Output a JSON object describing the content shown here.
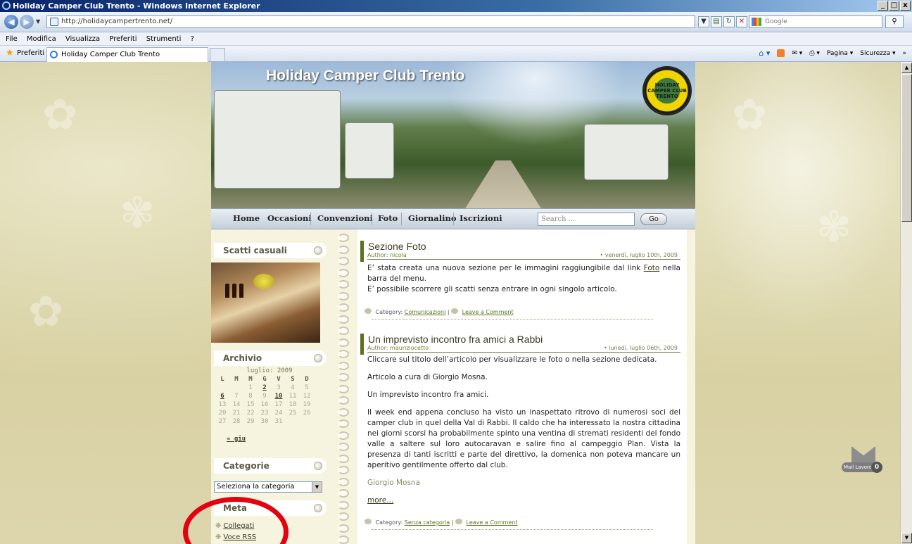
{
  "window": {
    "title": "Holiday Camper Club Trento - Windows Internet Explorer",
    "controls": [
      "_",
      "□",
      "x"
    ]
  },
  "address": {
    "url": "http://holidaycampertrento.net/",
    "search_placeholder": "Google"
  },
  "menu": [
    "File",
    "Modifica",
    "Visualizza",
    "Preferiti",
    "Strumenti",
    "?"
  ],
  "favorites": {
    "label": "Preferiti",
    "tab_title": "Holiday Camper Club Trento"
  },
  "command_bar": {
    "page": "Pagina ▾",
    "security": "Sicurezza ▾"
  },
  "site": {
    "title": "Holiday Camper Club Trento",
    "logo_text": "HOLIDAY CAMPER CLUB TRENTO",
    "nav": [
      "Home",
      "Occasioni",
      "Convenzioni",
      "Foto",
      "Giornalino",
      "Iscrizioni"
    ],
    "search_placeholder": "Search ...",
    "search_button": "Go"
  },
  "sidebar": {
    "random_title": "Scatti casuali",
    "archive_title": "Archivio",
    "calendar": {
      "caption": "luglio: 2009",
      "headers": [
        "L",
        "M",
        "M",
        "G",
        "V",
        "S",
        "D"
      ],
      "weeks": [
        [
          "",
          "",
          "1",
          "2",
          "3",
          "4",
          "5"
        ],
        [
          "6",
          "7",
          "8",
          "9",
          "10",
          "11",
          "12"
        ],
        [
          "13",
          "14",
          "15",
          "16",
          "17",
          "18",
          "19"
        ],
        [
          "20",
          "21",
          "22",
          "23",
          "24",
          "25",
          "26"
        ],
        [
          "27",
          "28",
          "29",
          "30",
          "31",
          "",
          ""
        ]
      ],
      "linked_days": [
        "2",
        "6",
        "10"
      ],
      "prev_link": "« giu"
    },
    "categories_title": "Categorie",
    "categories_select": "Seleziona la categoria",
    "meta_title": "Meta",
    "meta_links": [
      "Collegati",
      "Voce RSS"
    ]
  },
  "posts": [
    {
      "title": "Sezione Foto",
      "author_label": "Author:",
      "author": "nicola",
      "date": "• venerdì, luglio 10th, 2009",
      "body_1": "E’ stata creata una nuova sezione per le immagini raggiungibile dal link",
      "body_link": "Foto",
      "body_2": "nella barra del menu.",
      "body_3": "E’ possibile scorrere gli scatti senza entrare in ogni singolo articolo.",
      "category_label": "Category:",
      "category": "Comunicazioni",
      "comment": "Leave a Comment"
    },
    {
      "title": "Un imprevisto incontro fra amici a Rabbi",
      "author_label": "Author:",
      "author": "mauriziocetto",
      "date": "• lunedì, luglio 06th, 2009",
      "p1": "Cliccare sul titolo dell’articolo per visualizzare le foto o nella sezione dedicata.",
      "p2": "Articolo a cura di Giorgio Mosna.",
      "p3": "Un imprevisto incontro fra amici.",
      "p4": "Il week end appena concluso ha visto un inaspettato ritrovo di numerosi soci del camper club in quel della Val di Rabbi. Il caldo che ha interessato la nostra cittadina nei giorni scorsi ha probabilmente  spinto una ventina di stremati residenti del fondo valle a saltere sul loro autocaravan e salire fino al campeggio Plan. Vista la presenza di tanti iscritti e parte del direttivo, la domenica non poteva mancare un aperitivo gentilmente offerto dal club.",
      "p5": "Giorgio Mosna",
      "more": "more...",
      "category_label": "Category:",
      "category": "Senza categoria",
      "comment": "Leave a Comment"
    }
  ],
  "mail_widget": {
    "label": "Mail Lavoro",
    "count": "0"
  }
}
